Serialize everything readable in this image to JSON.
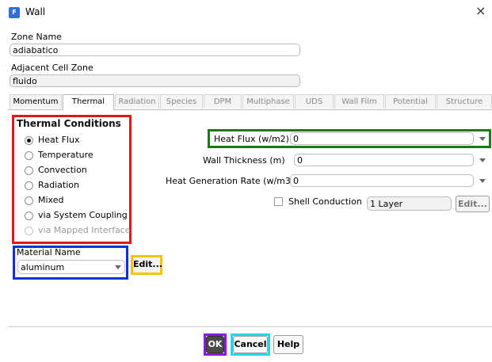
{
  "window": {
    "title": "Wall",
    "app_icon": "fluent-app-icon",
    "close_glyph": "×"
  },
  "zone_name": {
    "label": "Zone Name",
    "value": "adiabatico"
  },
  "adjacent_cell_zone": {
    "label": "Adjacent Cell Zone",
    "value": "fluido"
  },
  "tabs": [
    {
      "label": "Momentum"
    },
    {
      "label": "Thermal"
    },
    {
      "label": "Radiation"
    },
    {
      "label": "Species"
    },
    {
      "label": "DPM"
    },
    {
      "label": "Multiphase"
    },
    {
      "label": "UDS"
    },
    {
      "label": "Wall Film"
    },
    {
      "label": "Potential"
    },
    {
      "label": "Structure"
    }
  ],
  "active_tab": "Thermal",
  "thermal_conditions": {
    "title": "Thermal Conditions",
    "options": [
      {
        "label": "Heat Flux",
        "selected": true,
        "enabled": true
      },
      {
        "label": "Temperature",
        "selected": false,
        "enabled": true
      },
      {
        "label": "Convection",
        "selected": false,
        "enabled": true
      },
      {
        "label": "Radiation",
        "selected": false,
        "enabled": true
      },
      {
        "label": "Mixed",
        "selected": false,
        "enabled": true
      },
      {
        "label": "via System Coupling",
        "selected": false,
        "enabled": true
      },
      {
        "label": "via Mapped Interface",
        "selected": false,
        "enabled": false
      }
    ]
  },
  "heat_flux": {
    "label": "Heat Flux (w/m2)",
    "value": "0"
  },
  "wall_thickness": {
    "label": "Wall Thickness (m)",
    "value": "0"
  },
  "heat_generation_rate": {
    "label": "Heat Generation Rate (w/m3)",
    "value": "0"
  },
  "shell_conduction": {
    "label": "Shell Conduction",
    "checked": false,
    "layers_value": "1 Layer",
    "edit_label": "Edit..."
  },
  "material": {
    "label": "Material Name",
    "value": "aluminum",
    "edit_label": "Edit..."
  },
  "buttons": {
    "ok": "OK",
    "cancel": "Cancel",
    "help": "Help"
  },
  "highlight_colors": {
    "red": "#e01818",
    "green": "#1a7a1a",
    "blue": "#1030d8",
    "yellow": "#f2c40c",
    "purple": "#8a1bd6",
    "cyan": "#21d8e8"
  }
}
